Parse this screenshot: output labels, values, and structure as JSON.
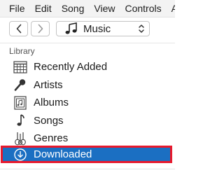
{
  "menu": {
    "items": [
      "File",
      "Edit",
      "Song",
      "View",
      "Controls",
      "Ac"
    ]
  },
  "toolbar": {
    "back_icon": "chevron-left",
    "forward_icon": "chevron-right",
    "media_type": "Music",
    "media_icon": "music-note",
    "dropdown_icon": "up-down-chevron"
  },
  "sidebar": {
    "section_title": "Library",
    "items": [
      {
        "label": "Recently Added",
        "icon": "grid-calendar"
      },
      {
        "label": "Artists",
        "icon": "microphone"
      },
      {
        "label": "Albums",
        "icon": "album"
      },
      {
        "label": "Songs",
        "icon": "music-note"
      },
      {
        "label": "Genres",
        "icon": "guitars"
      }
    ],
    "selected_item": {
      "label": "Downloaded",
      "icon": "download-circle"
    }
  },
  "colors": {
    "selection": "#1b6fc2",
    "highlight_outline": "#e8192c"
  }
}
